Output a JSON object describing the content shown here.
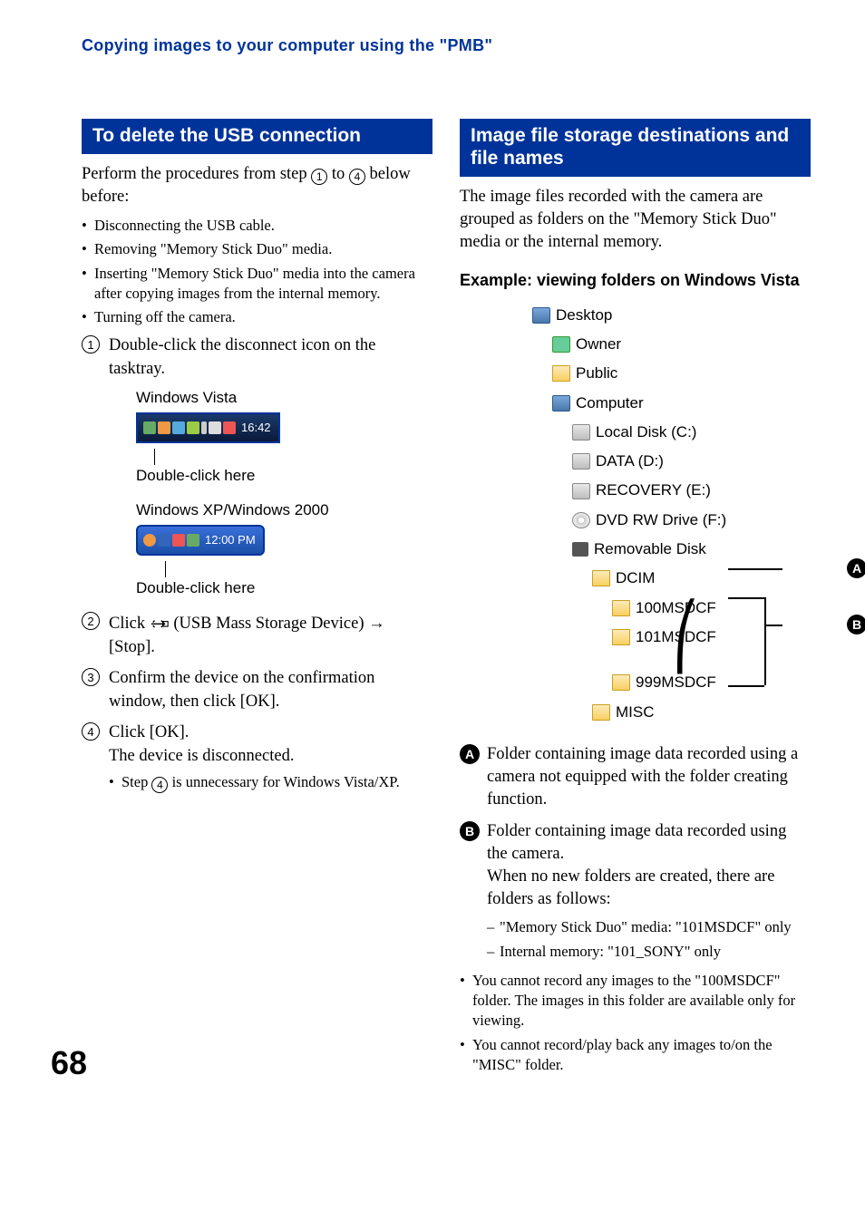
{
  "running_head": "Copying images to your computer using the \"PMB\"",
  "page_number": "68",
  "left": {
    "heading": "To delete the USB connection",
    "intro_before": "Perform the procedures from step ",
    "intro_circ1": "1",
    "intro_mid": " to ",
    "intro_circ2": "4",
    "intro_after": " below before:",
    "prewarn": [
      "Disconnecting the USB cable.",
      "Removing \"Memory Stick Duo\" media.",
      "Inserting \"Memory Stick Duo\" media into the camera after copying images from the internal memory.",
      "Turning off the camera."
    ],
    "step1": "Double-click the disconnect icon on the tasktray.",
    "vista_label": "Windows Vista",
    "vista_time": "16:42",
    "dbl_click_here": "Double-click here",
    "xp_label": "Windows XP/Windows 2000",
    "xp_time": "12:00 PM",
    "step2_a": "Click ",
    "step2_b": " (USB Mass Storage Device) ",
    "step2_c": "[Stop].",
    "step3": "Confirm the device on the confirmation window, then click [OK].",
    "step4": "Click [OK].",
    "step4_sub": "The device is disconnected.",
    "step4_note_a": "Step ",
    "step4_note_b": " is unnecessary for Windows Vista/XP."
  },
  "right": {
    "heading": "Image file storage destinations and file names",
    "intro": "The image files recorded with the camera are grouped as folders on the \"Memory Stick Duo\" media or the internal memory.",
    "example_head": "Example: viewing folders on Windows Vista",
    "tree": {
      "desktop": "Desktop",
      "owner": "Owner",
      "public": "Public",
      "computer": "Computer",
      "localdisk": "Local Disk (C:)",
      "data": "DATA (D:)",
      "recovery": "RECOVERY (E:)",
      "dvd": "DVD RW Drive (F:)",
      "remdisk": "Removable Disk",
      "dcim": "DCIM",
      "f100": "100MSDCF",
      "f101": "101MSDCF",
      "f999": "999MSDCF",
      "misc": "MISC"
    },
    "badge_a": "A",
    "badge_b": "B",
    "desc_a": "Folder containing image data recorded using a camera not equipped with the folder creating function.",
    "desc_b_1": "Folder containing image data recorded using the camera.",
    "desc_b_2": "When no new folders are created, there are folders as follows:",
    "dash1": "\"Memory Stick Duo\" media: \"101MSDCF\" only",
    "dash2": "Internal memory: \"101_SONY\" only",
    "notes": [
      "You cannot record any images to the \"100MSDCF\" folder. The images in this folder are available only for viewing.",
      "You cannot record/play back any images to/on the \"MISC\" folder."
    ]
  }
}
